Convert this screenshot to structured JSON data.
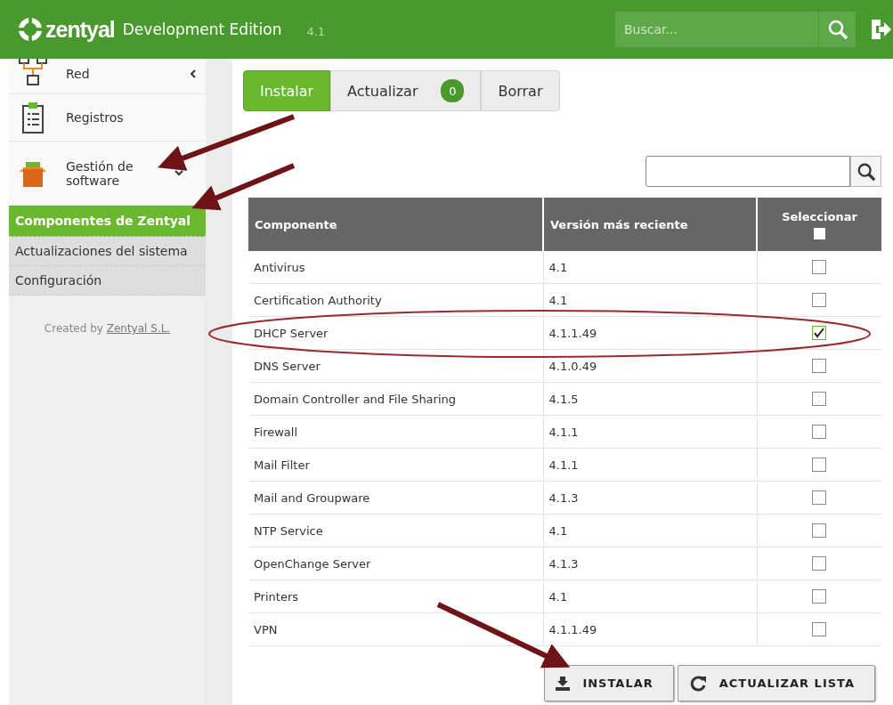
{
  "header": {
    "brand": "zentyal",
    "edition": "Development Edition",
    "version": "4.1",
    "search": {
      "placeholder": "Buscar..."
    }
  },
  "sidebar": {
    "items": [
      {
        "label": "Red",
        "kind": "network",
        "expanded": false
      },
      {
        "label": "Registros",
        "kind": "logs"
      },
      {
        "label": "Gestión de software",
        "kind": "software",
        "expanded": true,
        "children": [
          {
            "label": "Componentes de Zentyal",
            "selected": true
          },
          {
            "label": "Actualizaciones del sistema",
            "selected": false
          },
          {
            "label": "Configuración",
            "selected": false
          }
        ]
      }
    ],
    "credit": {
      "prefix": "Created by",
      "link": "Zentyal S.L."
    }
  },
  "tabs": [
    {
      "label": "Instalar",
      "selected": true
    },
    {
      "label": "Actualizar",
      "selected": false,
      "badge": "0"
    },
    {
      "label": "Borrar",
      "selected": false
    }
  ],
  "table": {
    "columns": [
      "Componente",
      "Versión más reciente",
      "Seleccionar"
    ],
    "select_all": false,
    "rows": [
      {
        "name": "Antivirus",
        "version": "4.1",
        "checked": false
      },
      {
        "name": "Certification Authority",
        "version": "4.1",
        "checked": false
      },
      {
        "name": "DHCP Server",
        "version": "4.1.1.49",
        "checked": true
      },
      {
        "name": "DNS Server",
        "version": "4.1.0.49",
        "checked": false
      },
      {
        "name": "Domain Controller and File Sharing",
        "version": "4.1.5",
        "checked": false
      },
      {
        "name": "Firewall",
        "version": "4.1.1",
        "checked": false
      },
      {
        "name": "Mail Filter",
        "version": "4.1.1",
        "checked": false
      },
      {
        "name": "Mail and Groupware",
        "version": "4.1.3",
        "checked": false
      },
      {
        "name": "NTP Service",
        "version": "4.1",
        "checked": false
      },
      {
        "name": "OpenChange Server",
        "version": "4.1.3",
        "checked": false
      },
      {
        "name": "Printers",
        "version": "4.1",
        "checked": false
      },
      {
        "name": "VPN",
        "version": "4.1.1.49",
        "checked": false
      }
    ]
  },
  "buttons": [
    {
      "label": "INSTALAR",
      "kind": "install"
    },
    {
      "label": "ACTUALIZAR LISTA",
      "kind": "refresh"
    }
  ]
}
